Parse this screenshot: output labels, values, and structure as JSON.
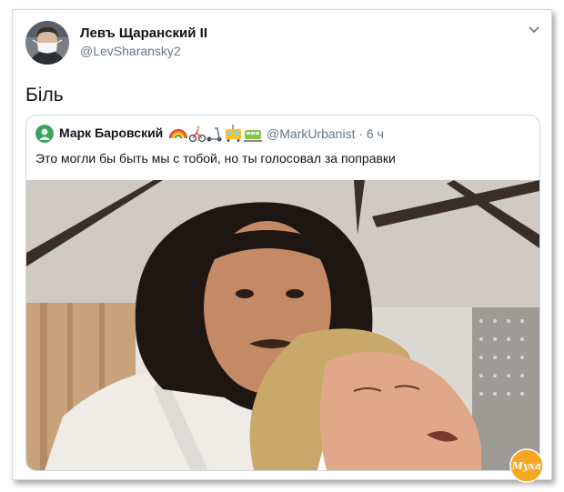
{
  "tweet": {
    "author_name": "Левъ Щаранский II",
    "author_handle": "@LevSharansky2",
    "text": "Біль"
  },
  "quoted_tweet": {
    "author_name": "Марк Баровский",
    "name_emojis": [
      "rainbow-icon",
      "cyclist-icon",
      "scooter-icon",
      "tram-icon",
      "train-icon"
    ],
    "handle_and_time": "@MarkUrbanist · 6 ч",
    "text": "Это могли бы быть мы с тобой, но ты голосовал за поправки",
    "photo": "two-men-selfie-photo"
  },
  "watermark": {
    "text": "Муха",
    "color": "#f5a623"
  },
  "colors": {
    "secondary_text": "#657786",
    "border": "#cfd9de"
  }
}
